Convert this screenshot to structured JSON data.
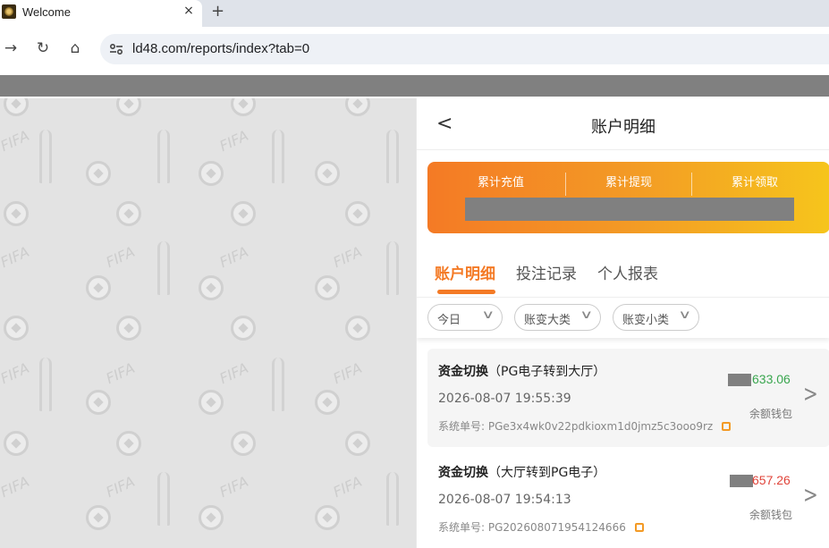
{
  "browser": {
    "tab_title": "Welcome",
    "tab_close": "×",
    "new_tab": "+",
    "url": "ld48.com/reports/index?tab=0",
    "back": "←",
    "forward": "→",
    "reload": "↻",
    "home": "⌂"
  },
  "background": {
    "watermark_text": "FIFA"
  },
  "panel": {
    "back_symbol": "<",
    "title": "账户明细",
    "summary": {
      "labels": [
        "累计充值",
        "累计提现",
        "累计领取"
      ],
      "values_masked": true
    },
    "tabs": [
      {
        "label": "账户明细",
        "active": true
      },
      {
        "label": "投注记录",
        "active": false
      },
      {
        "label": "个人报表",
        "active": false
      }
    ],
    "filters": [
      {
        "label": "今日"
      },
      {
        "label": "账变大类"
      },
      {
        "label": "账变小类"
      }
    ],
    "records": [
      {
        "type": "资金切换",
        "detail": "（PG电子转到大厅）",
        "time": "2026-08-07 19:55:39",
        "order_label": "系统单号:",
        "order_no": "PGe3x4wk0v22pdkioxm1d0jmz5c3ooo9rz",
        "amount": "633.06",
        "amount_color": "#3aa64f",
        "wallet": "余额钱包"
      },
      {
        "type": "资金切换",
        "detail": "（大厅转到PG电子）",
        "time": "2026-08-07 19:54:13",
        "order_label": "系统单号:",
        "order_no": "PG202608071954124666",
        "amount": "657.26",
        "amount_color": "#e0443a",
        "wallet": "余额钱包"
      }
    ]
  },
  "colors": {
    "accent": "#f47a25",
    "card_start": "#f47a25",
    "card_end": "#f6c51c"
  }
}
